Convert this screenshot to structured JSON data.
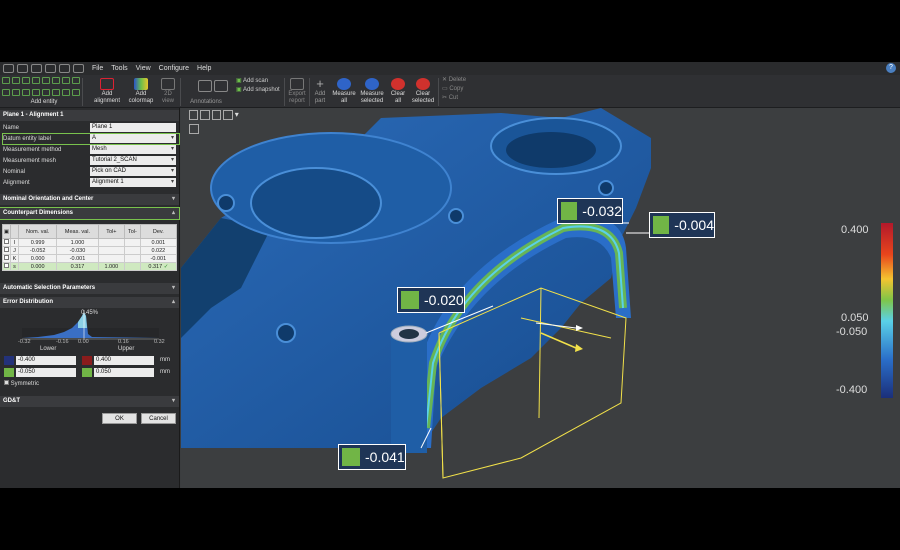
{
  "menubar": {
    "items": [
      "File",
      "Tools",
      "View",
      "Configure",
      "Help"
    ]
  },
  "ribbon": {
    "add_entity": "Add entity",
    "add_alignment": "Add alignment",
    "add_colormap": "Add colormap",
    "view_2d": "2D view",
    "annotations": "Annotations",
    "add_scan": "Add scan",
    "add_snapshot": "Add snapshot",
    "export_report": "Export report",
    "add_part": "Add part",
    "measure_all": "Measure all",
    "measure_selected": "Measure selected",
    "clear_all": "Clear all",
    "clear_selected": "Clear selected",
    "delete": "Delete",
    "copy": "Copy",
    "cut": "Cut"
  },
  "panel": {
    "title": "Plane 1 - Alignment 1",
    "props": [
      {
        "label": "Name",
        "value": "Plane 1"
      },
      {
        "label": "Datum entity label",
        "value": "A"
      },
      {
        "label": "Measurement method",
        "value": "Mesh"
      },
      {
        "label": "Measurement mesh",
        "value": "Tutorial 2_SCAN"
      },
      {
        "label": "Nominal",
        "value": "Pick on CAD"
      },
      {
        "label": "Alignment",
        "value": "Alignment 1"
      }
    ],
    "nominal_orientation": "Nominal Orientation and Center",
    "counterpart": "Counterpart Dimensions",
    "table_headers": [
      "Nom. val.",
      "Meas. val.",
      "Tol+",
      "Tol-",
      "Dev."
    ],
    "table_rows": [
      {
        "axis": "I",
        "nom": "0.999",
        "meas": "1.000",
        "tolp": "",
        "tolm": "",
        "dev": "0.001"
      },
      {
        "axis": "J",
        "nom": "-0.052",
        "meas": "-0.030",
        "tolp": "",
        "tolm": "",
        "dev": "0.022"
      },
      {
        "axis": "K",
        "nom": "0.000",
        "meas": "-0.001",
        "tolp": "",
        "tolm": "",
        "dev": "-0.001"
      },
      {
        "axis": "s",
        "nom": "0.000",
        "meas": "0.317",
        "tolp": "1.000",
        "tolm": "",
        "dev": "0.317"
      }
    ],
    "auto_selection": "Automatic Selection Parameters",
    "error_distribution": "Error Distribution",
    "histo_pct": "0.45%",
    "histo_ticks": [
      "-0.32",
      "-0.16",
      "0.00",
      "0.16",
      "0.32"
    ],
    "lower_label": "Lower",
    "upper_label": "Upper",
    "lower_outer": "-0.400",
    "upper_outer": "0.400",
    "lower_inner": "-0.050",
    "upper_inner": "0.050",
    "unit": "mm",
    "symmetric": "Symmetric",
    "gdt": "GD&T",
    "ok": "OK",
    "cancel": "Cancel"
  },
  "viewport": {
    "callouts": [
      "-0.032",
      "-0.004",
      "-0.020",
      "-0.041"
    ],
    "scale": [
      "0.400",
      "0.050",
      "-0.050",
      "-0.400"
    ]
  },
  "colors": {
    "accent": "#79c24d",
    "part_blue": "#1f5ea6",
    "callout_bg": "#1f3556"
  }
}
